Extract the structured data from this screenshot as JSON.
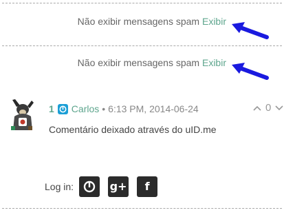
{
  "spam_notices": [
    {
      "text": "Não exibir mensagens spam",
      "link": "Exibir"
    },
    {
      "text": "Não exibir mensagens spam",
      "link": "Exibir"
    }
  ],
  "comment": {
    "points": "1",
    "author": "Carlos",
    "separator": "•",
    "timestamp": "6:13 PM, 2014-06-24",
    "body": "Comentário deixado através do uID.me",
    "vote_count": "0"
  },
  "login": {
    "label": "Log in:",
    "google_glyph": "g+",
    "facebook_glyph": "f"
  },
  "colors": {
    "link": "#5da58d",
    "arrow": "#1a1adf",
    "uid_badge": "#1c9fd6",
    "login_button": "#2b2b2b"
  }
}
